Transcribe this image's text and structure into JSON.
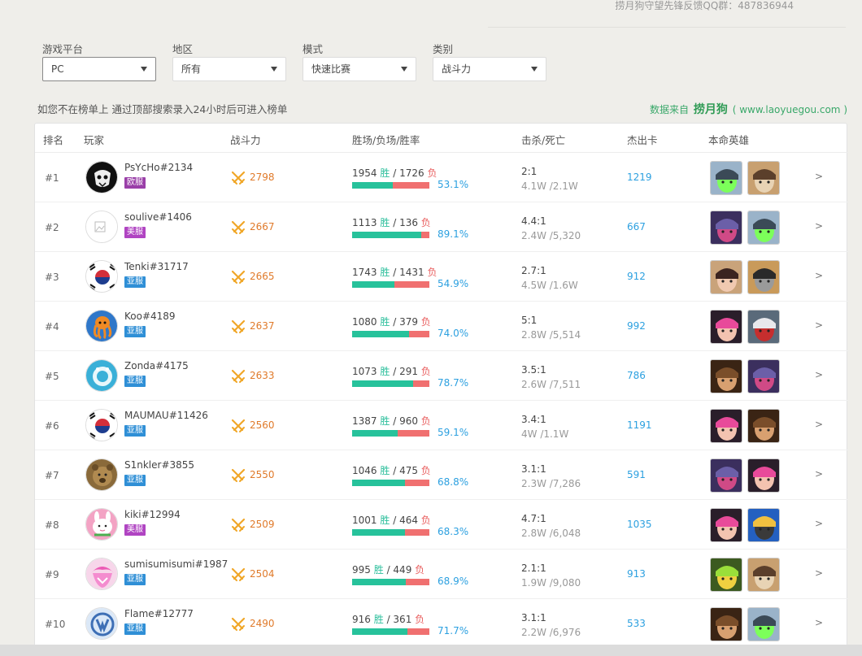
{
  "header": {
    "qq_note": "捞月狗守望先锋反馈QQ群：487836944"
  },
  "filters": [
    {
      "label": "游戏平台",
      "value": "PC",
      "active": true
    },
    {
      "label": "地区",
      "value": "所有",
      "active": false
    },
    {
      "label": "模式",
      "value": "快速比赛",
      "active": false
    },
    {
      "label": "类别",
      "value": "战斗力",
      "active": false
    }
  ],
  "notice": "如您不在榜单上 通过顶部搜索录入24小时后可进入榜单",
  "source": {
    "prefix": "数据来自",
    "logo": "捞月狗",
    "url": "( www.laoyuegou.com )"
  },
  "columns": {
    "rank": "排名",
    "player": "玩家",
    "power": "战斗力",
    "winloss": "胜场/负场/胜率",
    "kd": "击杀/死亡",
    "cards": "杰出卡",
    "heroes": "本命英雄"
  },
  "labels": {
    "win": "胜",
    "loss": "负",
    "arrow": ">"
  },
  "colors": {
    "win": "#27c29b",
    "loss": "#f07070",
    "rate": "#2ca0e0",
    "power": "#e07a2a"
  },
  "rows": [
    {
      "rank": "#1",
      "name": "PsYcHo#2134",
      "server": "欧服",
      "server_type": "eu",
      "power": "2798",
      "wins": "1954",
      "losses": "1726",
      "rate": "53.1%",
      "win_frac": 0.531,
      "kd": "2:1",
      "kd_detail": "4.1W /2.1W",
      "cards": "1219",
      "avatar": "reaper",
      "heroes": [
        "genji-hero-icon",
        "roadhog-hero-icon"
      ]
    },
    {
      "rank": "#2",
      "name": "soulive#1406",
      "server": "美服",
      "server_type": "us",
      "power": "2667",
      "wins": "1113",
      "losses": "136",
      "rate": "89.1%",
      "win_frac": 0.891,
      "kd": "4.4:1",
      "kd_detail": "2.4W /5,320",
      "cards": "667",
      "avatar": "broken",
      "heroes": [
        "widowmaker-hero-icon",
        "genji-hero-icon"
      ]
    },
    {
      "rank": "#3",
      "name": "Tenki#31717",
      "server": "亚服",
      "server_type": "as",
      "power": "2665",
      "wins": "1743",
      "losses": "1431",
      "rate": "54.9%",
      "win_frac": 0.549,
      "kd": "2.7:1",
      "kd_detail": "4.5W /1.6W",
      "cards": "912",
      "avatar": "korea",
      "heroes": [
        "dva-hero-icon",
        "junkrat-hero-icon"
      ]
    },
    {
      "rank": "#4",
      "name": "Koo#4189",
      "server": "亚服",
      "server_type": "as",
      "power": "2637",
      "wins": "1080",
      "losses": "379",
      "rate": "74.0%",
      "win_frac": 0.74,
      "kd": "5:1",
      "kd_detail": "2.8W /5,514",
      "cards": "992",
      "avatar": "octopus",
      "heroes": [
        "zarya-hero-icon",
        "soldier76-hero-icon"
      ]
    },
    {
      "rank": "#5",
      "name": "Zonda#4175",
      "server": "亚服",
      "server_type": "as",
      "power": "2633",
      "wins": "1073",
      "losses": "291",
      "rate": "78.7%",
      "win_frac": 0.787,
      "kd": "3.5:1",
      "kd_detail": "2.6W /7,511",
      "cards": "786",
      "avatar": "zenyatta",
      "heroes": [
        "mccree-hero-icon",
        "widowmaker-hero-icon"
      ]
    },
    {
      "rank": "#6",
      "name": "MAUMAU#11426",
      "server": "亚服",
      "server_type": "as",
      "power": "2560",
      "wins": "1387",
      "losses": "960",
      "rate": "59.1%",
      "win_frac": 0.591,
      "kd": "3.4:1",
      "kd_detail": "4W /1.1W",
      "cards": "1191",
      "avatar": "korea",
      "heroes": [
        "zarya-hero-icon",
        "mccree-hero-icon"
      ]
    },
    {
      "rank": "#7",
      "name": "S1nkler#3855",
      "server": "亚服",
      "server_type": "as",
      "power": "2550",
      "wins": "1046",
      "losses": "475",
      "rate": "68.8%",
      "win_frac": 0.688,
      "kd": "3.1:1",
      "kd_detail": "2.3W /7,286",
      "cards": "591",
      "avatar": "bear",
      "heroes": [
        "widowmaker-hero-icon",
        "zarya-hero-icon"
      ]
    },
    {
      "rank": "#8",
      "name": "kiki#12994",
      "server": "美服",
      "server_type": "us",
      "power": "2509",
      "wins": "1001",
      "losses": "464",
      "rate": "68.3%",
      "win_frac": 0.683,
      "kd": "4.7:1",
      "kd_detail": "2.8W /6,048",
      "cards": "1035",
      "avatar": "bunny",
      "heroes": [
        "zarya-hero-icon",
        "pharah-hero-icon"
      ]
    },
    {
      "rank": "#9",
      "name": "sumisumisumi#1987",
      "server": "亚服",
      "server_type": "as",
      "power": "2504",
      "wins": "995",
      "losses": "449",
      "rate": "68.9%",
      "win_frac": 0.689,
      "kd": "2.1:1",
      "kd_detail": "1.9W /9,080",
      "cards": "913",
      "avatar": "pinkhair",
      "heroes": [
        "lucio-hero-icon",
        "roadhog-hero-icon"
      ]
    },
    {
      "rank": "#10",
      "name": "Flame#12777",
      "server": "亚服",
      "server_type": "as",
      "power": "2490",
      "wins": "916",
      "losses": "361",
      "rate": "71.7%",
      "win_frac": 0.717,
      "kd": "3.1:1",
      "kd_detail": "2.2W /6,976",
      "cards": "533",
      "avatar": "ow-logo",
      "heroes": [
        "mccree-hero-icon",
        "genji-hero-icon"
      ]
    }
  ]
}
